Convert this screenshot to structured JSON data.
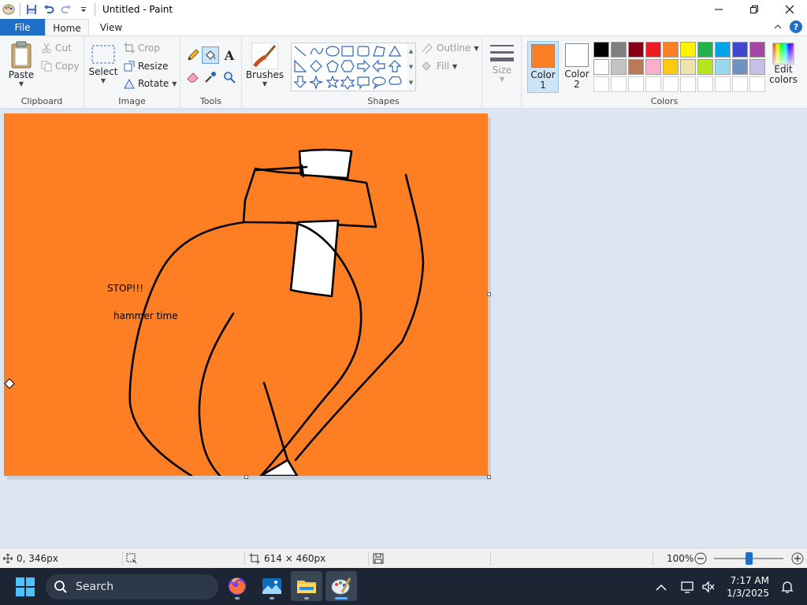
{
  "window": {
    "title": "Untitled - Paint"
  },
  "tabs": {
    "file": "File",
    "home": "Home",
    "view": "View"
  },
  "help": {
    "glyph": "?"
  },
  "clipboard": {
    "label": "Clipboard",
    "paste": "Paste",
    "cut": "Cut",
    "copy": "Copy"
  },
  "image": {
    "label": "Image",
    "select": "Select",
    "crop": "Crop",
    "resize": "Resize",
    "rotate": "Rotate"
  },
  "tools": {
    "label": "Tools",
    "text_glyph": "A"
  },
  "brushes": {
    "label": "Brushes"
  },
  "shapes": {
    "label": "Shapes",
    "outline": "Outline",
    "fill": "Fill"
  },
  "size": {
    "label": "Size"
  },
  "colors": {
    "label": "Colors",
    "color1_line1": "Color",
    "color1_line2": "1",
    "color1_value": "#fe7f23",
    "color2_line1": "Color",
    "color2_line2": "2",
    "color2_value": "#ffffff",
    "edit_line1": "Edit",
    "edit_line2": "colors",
    "palette_row1": [
      "#000000",
      "#7f7f7f",
      "#880015",
      "#ed1c24",
      "#ff7f27",
      "#fff200",
      "#22b14c",
      "#00a2e8",
      "#3f48cc",
      "#a349a4"
    ],
    "palette_row2": [
      "#ffffff",
      "#c3c3c3",
      "#b97a57",
      "#ffaec9",
      "#ffc90e",
      "#efe4b0",
      "#b5e61d",
      "#99d9ea",
      "#7092be",
      "#c8bfe7"
    ],
    "palette_row3": [
      "#ffffff",
      "#ffffff",
      "#ffffff",
      "#ffffff",
      "#ffffff",
      "#ffffff",
      "#ffffff",
      "#ffffff",
      "#ffffff",
      "#ffffff"
    ]
  },
  "canvas": {
    "background": "#fe7f23",
    "text1": "STOP!!!",
    "text2": "hammer time"
  },
  "status": {
    "cursor_pos": "0, 346px",
    "canvas_size": "614 × 460px",
    "zoom": "100%",
    "zoom_fraction": 0.5
  },
  "taskbar": {
    "search": "Search",
    "time": "7:17 AM",
    "date": "1/3/2025"
  }
}
